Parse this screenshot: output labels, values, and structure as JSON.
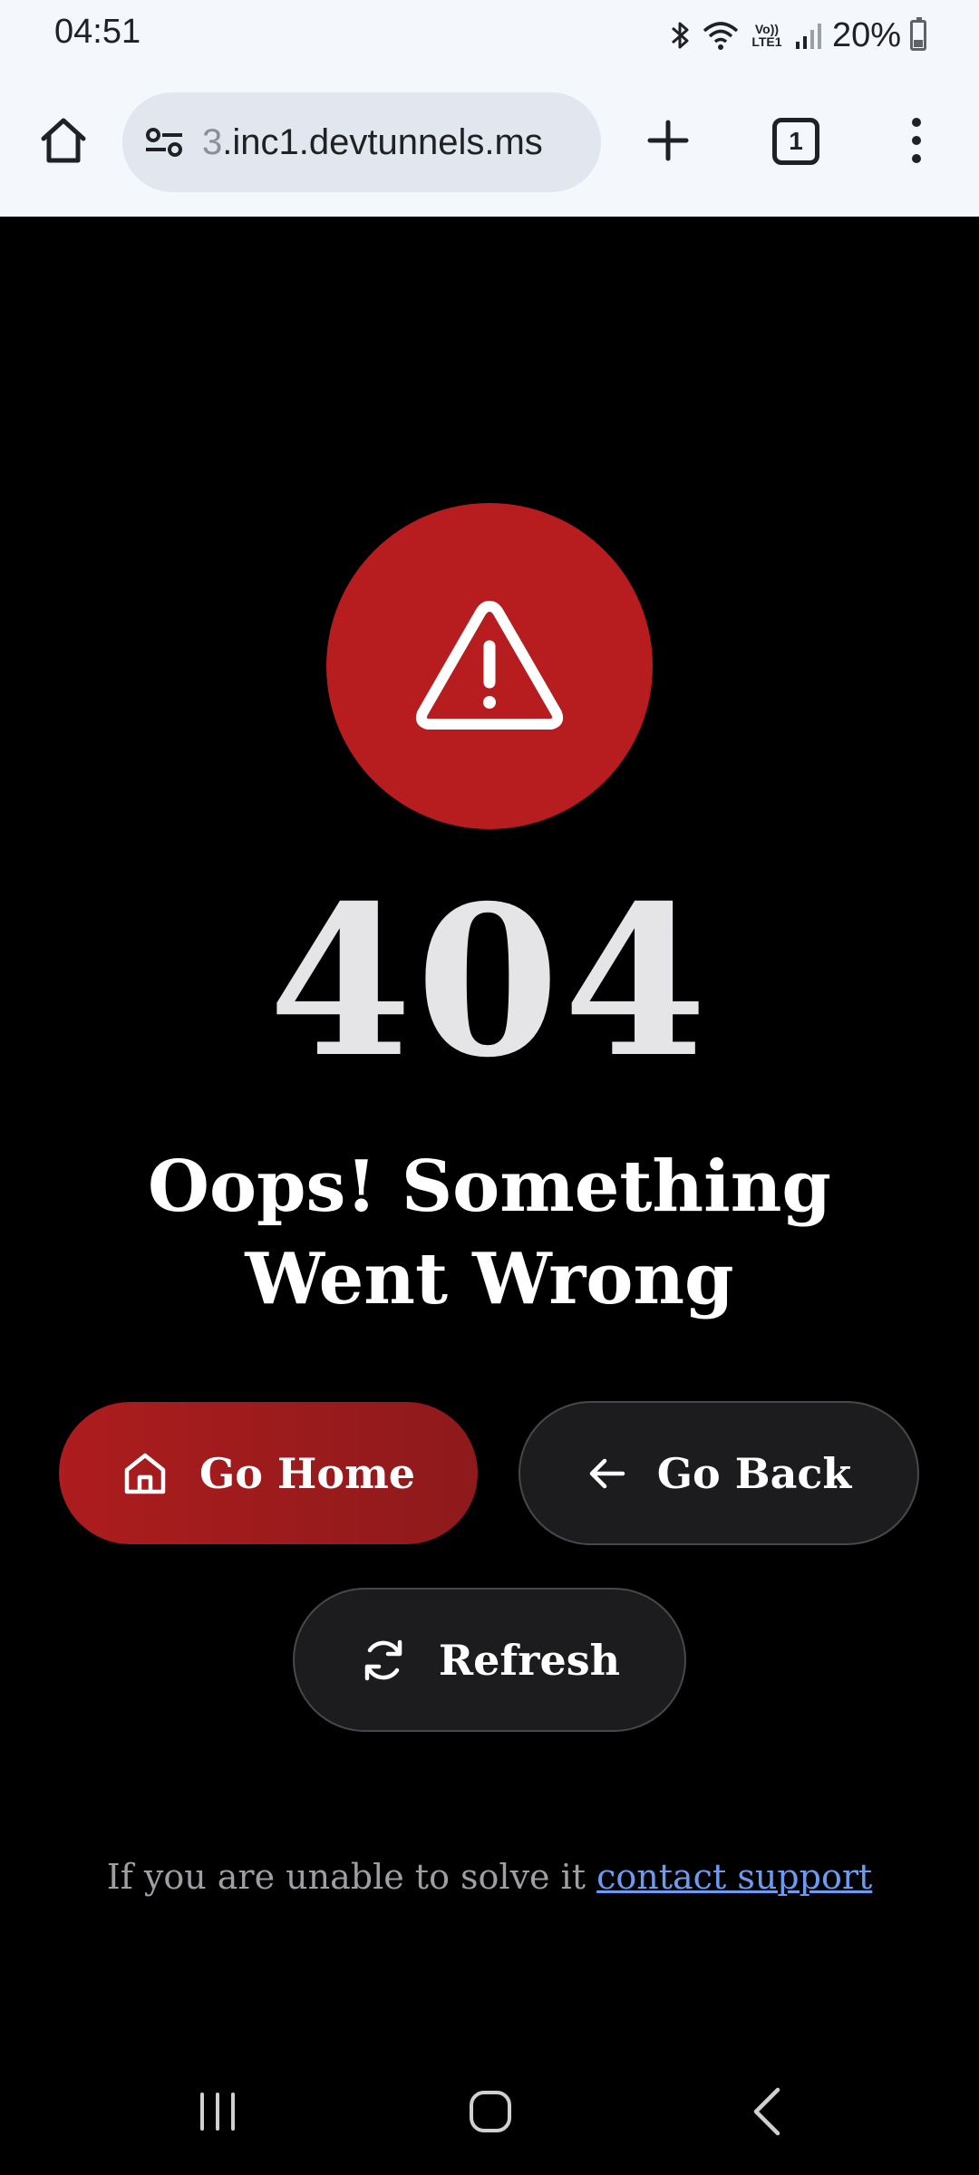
{
  "status_bar": {
    "time": "04:51",
    "network_label": "Vo)) LTE1",
    "battery": "20%"
  },
  "browser": {
    "url_faded": "3",
    "url_main": ".inc1.devtunnels.ms",
    "tab_count": "1"
  },
  "page": {
    "error_code": "404",
    "headline": "Oops! Something Went Wrong",
    "buttons": {
      "home": "Go Home",
      "back": "Go Back",
      "refresh": "Refresh"
    },
    "support_text": "If you are unable to solve it",
    "support_link": "contact support"
  },
  "colors": {
    "accent_red": "#b71c1e",
    "background": "#000000",
    "link": "#6b9cf2"
  },
  "icons": [
    "home-icon",
    "tune-icon",
    "plus-icon",
    "menu-icon",
    "warning-icon",
    "arrow-left-icon",
    "refresh-icon"
  ]
}
